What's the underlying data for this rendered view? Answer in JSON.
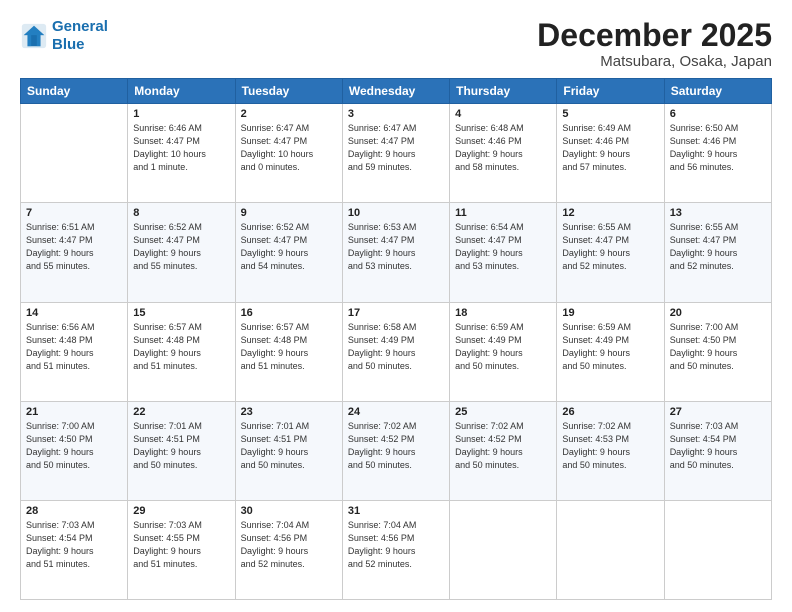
{
  "logo": {
    "line1": "General",
    "line2": "Blue"
  },
  "title": "December 2025",
  "subtitle": "Matsubara, Osaka, Japan",
  "weekdays": [
    "Sunday",
    "Monday",
    "Tuesday",
    "Wednesday",
    "Thursday",
    "Friday",
    "Saturday"
  ],
  "weeks": [
    [
      {
        "day": "",
        "info": ""
      },
      {
        "day": "1",
        "info": "Sunrise: 6:46 AM\nSunset: 4:47 PM\nDaylight: 10 hours\nand 1 minute."
      },
      {
        "day": "2",
        "info": "Sunrise: 6:47 AM\nSunset: 4:47 PM\nDaylight: 10 hours\nand 0 minutes."
      },
      {
        "day": "3",
        "info": "Sunrise: 6:47 AM\nSunset: 4:47 PM\nDaylight: 9 hours\nand 59 minutes."
      },
      {
        "day": "4",
        "info": "Sunrise: 6:48 AM\nSunset: 4:46 PM\nDaylight: 9 hours\nand 58 minutes."
      },
      {
        "day": "5",
        "info": "Sunrise: 6:49 AM\nSunset: 4:46 PM\nDaylight: 9 hours\nand 57 minutes."
      },
      {
        "day": "6",
        "info": "Sunrise: 6:50 AM\nSunset: 4:46 PM\nDaylight: 9 hours\nand 56 minutes."
      }
    ],
    [
      {
        "day": "7",
        "info": "Sunrise: 6:51 AM\nSunset: 4:47 PM\nDaylight: 9 hours\nand 55 minutes."
      },
      {
        "day": "8",
        "info": "Sunrise: 6:52 AM\nSunset: 4:47 PM\nDaylight: 9 hours\nand 55 minutes."
      },
      {
        "day": "9",
        "info": "Sunrise: 6:52 AM\nSunset: 4:47 PM\nDaylight: 9 hours\nand 54 minutes."
      },
      {
        "day": "10",
        "info": "Sunrise: 6:53 AM\nSunset: 4:47 PM\nDaylight: 9 hours\nand 53 minutes."
      },
      {
        "day": "11",
        "info": "Sunrise: 6:54 AM\nSunset: 4:47 PM\nDaylight: 9 hours\nand 53 minutes."
      },
      {
        "day": "12",
        "info": "Sunrise: 6:55 AM\nSunset: 4:47 PM\nDaylight: 9 hours\nand 52 minutes."
      },
      {
        "day": "13",
        "info": "Sunrise: 6:55 AM\nSunset: 4:47 PM\nDaylight: 9 hours\nand 52 minutes."
      }
    ],
    [
      {
        "day": "14",
        "info": "Sunrise: 6:56 AM\nSunset: 4:48 PM\nDaylight: 9 hours\nand 51 minutes."
      },
      {
        "day": "15",
        "info": "Sunrise: 6:57 AM\nSunset: 4:48 PM\nDaylight: 9 hours\nand 51 minutes."
      },
      {
        "day": "16",
        "info": "Sunrise: 6:57 AM\nSunset: 4:48 PM\nDaylight: 9 hours\nand 51 minutes."
      },
      {
        "day": "17",
        "info": "Sunrise: 6:58 AM\nSunset: 4:49 PM\nDaylight: 9 hours\nand 50 minutes."
      },
      {
        "day": "18",
        "info": "Sunrise: 6:59 AM\nSunset: 4:49 PM\nDaylight: 9 hours\nand 50 minutes."
      },
      {
        "day": "19",
        "info": "Sunrise: 6:59 AM\nSunset: 4:49 PM\nDaylight: 9 hours\nand 50 minutes."
      },
      {
        "day": "20",
        "info": "Sunrise: 7:00 AM\nSunset: 4:50 PM\nDaylight: 9 hours\nand 50 minutes."
      }
    ],
    [
      {
        "day": "21",
        "info": "Sunrise: 7:00 AM\nSunset: 4:50 PM\nDaylight: 9 hours\nand 50 minutes."
      },
      {
        "day": "22",
        "info": "Sunrise: 7:01 AM\nSunset: 4:51 PM\nDaylight: 9 hours\nand 50 minutes."
      },
      {
        "day": "23",
        "info": "Sunrise: 7:01 AM\nSunset: 4:51 PM\nDaylight: 9 hours\nand 50 minutes."
      },
      {
        "day": "24",
        "info": "Sunrise: 7:02 AM\nSunset: 4:52 PM\nDaylight: 9 hours\nand 50 minutes."
      },
      {
        "day": "25",
        "info": "Sunrise: 7:02 AM\nSunset: 4:52 PM\nDaylight: 9 hours\nand 50 minutes."
      },
      {
        "day": "26",
        "info": "Sunrise: 7:02 AM\nSunset: 4:53 PM\nDaylight: 9 hours\nand 50 minutes."
      },
      {
        "day": "27",
        "info": "Sunrise: 7:03 AM\nSunset: 4:54 PM\nDaylight: 9 hours\nand 50 minutes."
      }
    ],
    [
      {
        "day": "28",
        "info": "Sunrise: 7:03 AM\nSunset: 4:54 PM\nDaylight: 9 hours\nand 51 minutes."
      },
      {
        "day": "29",
        "info": "Sunrise: 7:03 AM\nSunset: 4:55 PM\nDaylight: 9 hours\nand 51 minutes."
      },
      {
        "day": "30",
        "info": "Sunrise: 7:04 AM\nSunset: 4:56 PM\nDaylight: 9 hours\nand 52 minutes."
      },
      {
        "day": "31",
        "info": "Sunrise: 7:04 AM\nSunset: 4:56 PM\nDaylight: 9 hours\nand 52 minutes."
      },
      {
        "day": "",
        "info": ""
      },
      {
        "day": "",
        "info": ""
      },
      {
        "day": "",
        "info": ""
      }
    ]
  ]
}
